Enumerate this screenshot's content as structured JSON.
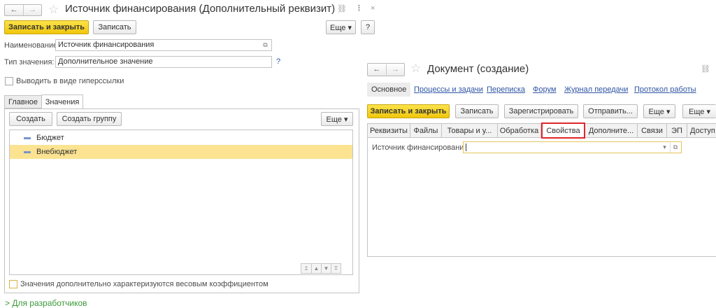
{
  "left": {
    "nav": {
      "back": "←",
      "forward": "→"
    },
    "title": "Источник финансирования (Дополнительный реквизит)",
    "header_icons": {
      "link": "⛓",
      "more": "⋮",
      "close": "×"
    },
    "toolbar": {
      "save_close": "Записать и закрыть",
      "save": "Записать",
      "more": "Еще ▾",
      "help": "?"
    },
    "fields": {
      "name_label": "Наименование:",
      "name_value": "Источник финансирования",
      "type_label": "Тип значения:",
      "type_value": "Дополнительное значение",
      "type_help": "?"
    },
    "hyperlink_checkbox": "Выводить в виде гиперссылки",
    "tabs": [
      "Главное",
      "Значения"
    ],
    "values_toolbar": {
      "create": "Создать",
      "create_group": "Создать группу",
      "more": "Еще ▾"
    },
    "values_list": [
      {
        "label": "Бюджет",
        "selected": false
      },
      {
        "label": "Внебюджет",
        "selected": true
      }
    ],
    "scroll_buttons": [
      "⩲",
      "▲",
      "▼",
      "⩱"
    ],
    "weight_checkbox": "Значения дополнительно характеризуются весовым коэффициентом",
    "dev_link": "> Для разработчиков"
  },
  "right": {
    "nav": {
      "back": "←",
      "forward": "→"
    },
    "title": "Документ (создание)",
    "link_icon": "⛓",
    "nav_links": [
      "Основное",
      "Процессы и задачи",
      "Переписка",
      "Форум",
      "Журнал передачи",
      "Протокол работы"
    ],
    "toolbar": {
      "save_close": "Записать и закрыть",
      "save": "Записать",
      "register": "Зарегистрировать",
      "send": "Отправить...",
      "more1": "Еще ▾",
      "more2": "Еще ▾"
    },
    "subtabs": [
      "Реквизиты",
      "Файлы",
      "Товары и у...",
      "Обработка",
      "Свойства",
      "Дополните...",
      "Связи",
      "ЭП",
      "Доступ"
    ],
    "field_label": "Источник финансирования:",
    "field_value": "",
    "field_dropdown": "▾"
  },
  "colors": {
    "accent_yellow": "#f5d21a",
    "selected_row": "#fbe392",
    "link_blue": "#2e55a4",
    "highlight_red": "#e0262c",
    "dev_green": "#3a9a3a"
  }
}
